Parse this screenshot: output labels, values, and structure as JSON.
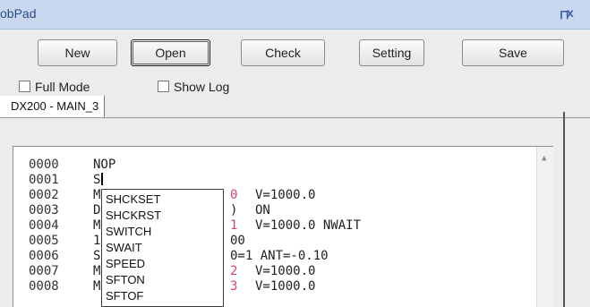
{
  "window": {
    "title": "obPad",
    "pin_glyph": "ᅟ⊓",
    "close_glyph": "x"
  },
  "toolbar": {
    "new_label": "New",
    "open_label": "Open",
    "check_label": "Check",
    "setting_label": "Setting",
    "save_label": "Save"
  },
  "options": {
    "full_mode_label": "Full Mode",
    "show_log_label": "Show Log"
  },
  "tabs": [
    {
      "label": "DX200 - MAIN_3"
    }
  ],
  "editor": {
    "lines": [
      {
        "num": "0000",
        "text": "NOP"
      },
      {
        "num": "0001",
        "text": "S"
      },
      {
        "num": "0002",
        "lead": "M",
        "tail_digit": "0",
        "tail": "V=1000.0"
      },
      {
        "num": "0003",
        "lead": "D",
        "tail_digit": ")",
        "tail": "ON"
      },
      {
        "num": "0004",
        "lead": "M",
        "tail_digit": "1",
        "tail": "V=1000.0 NWAIT"
      },
      {
        "num": "0005",
        "lead": "1",
        "tail_digit": "",
        "tail": "00"
      },
      {
        "num": "0006",
        "lead": "S",
        "tail_digit": "",
        "tail": "0=1 ANT=-0.10"
      },
      {
        "num": "0007",
        "lead": "M",
        "tail_digit": "2",
        "tail": "V=1000.0"
      },
      {
        "num": "0008",
        "lead": "M",
        "tail_digit": "3",
        "tail": "V=1000.0"
      }
    ]
  },
  "autocomplete": {
    "items": [
      "SHCKSET",
      "SHCKRST",
      "SWITCH",
      "SWAIT",
      "SPEED",
      "SFTON",
      "SFTOF"
    ]
  },
  "icons": {
    "pin": "pin-icon",
    "close": "close-icon",
    "scroll_up": "scroll-up-arrow-icon"
  },
  "colors": {
    "titlebar": "#c9d8ef",
    "title_text": "#2c4d86",
    "keyword_magenta": "#d0457c"
  }
}
